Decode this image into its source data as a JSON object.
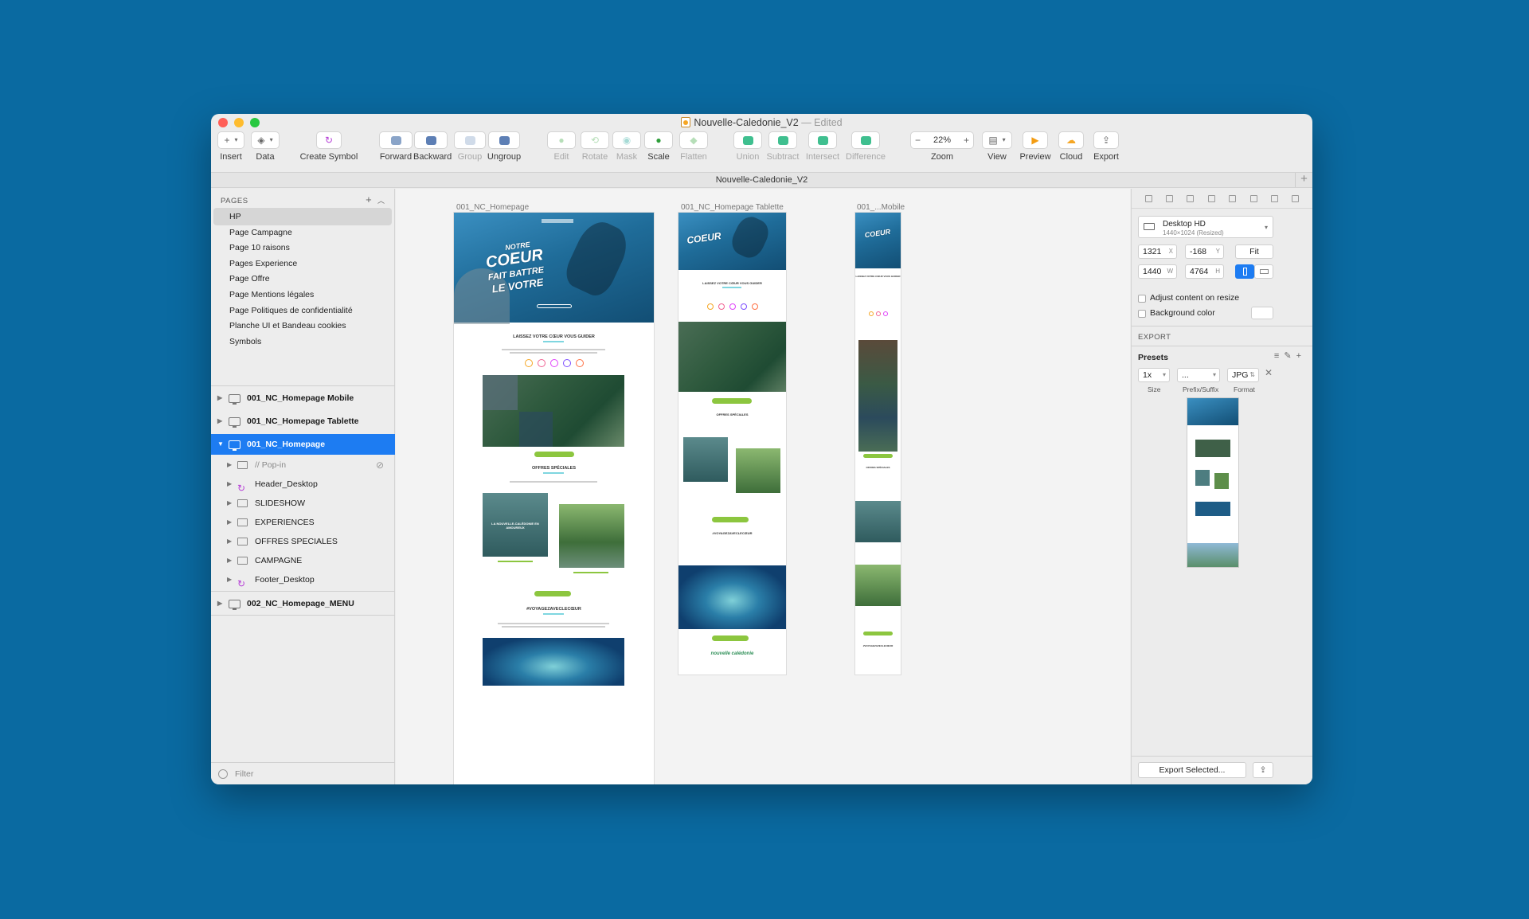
{
  "window": {
    "title": "Nouvelle-Caledonie_V2",
    "status": "— Edited",
    "document_tab": "Nouvelle-Caledonie_V2"
  },
  "toolbar": {
    "insert": "Insert",
    "data": "Data",
    "create_symbol": "Create Symbol",
    "forward": "Forward",
    "backward": "Backward",
    "group": "Group",
    "ungroup": "Ungroup",
    "edit": "Edit",
    "rotate": "Rotate",
    "mask": "Mask",
    "scale": "Scale",
    "flatten": "Flatten",
    "union": "Union",
    "subtract": "Subtract",
    "intersect": "Intersect",
    "difference": "Difference",
    "zoom_label": "Zoom",
    "zoom_value": "22%",
    "view": "View",
    "preview": "Preview",
    "cloud": "Cloud",
    "export": "Export"
  },
  "pages": {
    "header": "PAGES",
    "items": [
      "HP",
      "Page Campagne",
      "Page 10 raisons",
      "Pages Experience",
      "Page Offre",
      "Page Mentions légales",
      "Page Politiques de confidentialité",
      "Planche UI et Bandeau cookies",
      "Symbols"
    ],
    "selected": "HP"
  },
  "layers": {
    "artboards": [
      "001_NC_Homepage Mobile",
      "001_NC_Homepage Tablette",
      "001_NC_Homepage",
      "002_NC_Homepage_MENU"
    ],
    "children": [
      "// Pop-in",
      "Header_Desktop",
      "SLIDESHOW",
      "EXPERIENCES",
      "OFFRES SPECIALES",
      "CAMPAGNE",
      "Footer_Desktop"
    ],
    "filter_placeholder": "Filter"
  },
  "canvas": {
    "artboard_labels": [
      "001_NC_Homepage",
      "001_NC_Homepage Tablette",
      "001_...Mobile"
    ],
    "hero_line1": "NOTRE",
    "hero_line2": "COEUR",
    "hero_line3": "FAIT BATTRE",
    "hero_line4": "LE VOTRE",
    "section_guide": "LAISSEZ VOTRE CŒUR VOUS GUIDER",
    "section_offres": "OFFRES SPÉCIALES",
    "section_hashtag": "#VOYAGEZAVECLECŒUR",
    "brand": "nouvelle calédonie",
    "offer1": "LA NOUVELLE-CALÉDONIE EN AMOUREUX",
    "offer2": "COMME GRANDE TERRE ET ILE DES PINS"
  },
  "inspector": {
    "preset_name": "Desktop HD",
    "preset_size": "1440×1024 (Resized)",
    "x": "1321",
    "x_suffix": "X",
    "y": "-168",
    "y_suffix": "Y",
    "fit": "Fit",
    "w": "1440",
    "w_suffix": "W",
    "h": "4764",
    "h_suffix": "H",
    "adjust_content": "Adjust content on resize",
    "background_color": "Background color",
    "export_header": "EXPORT",
    "presets": "Presets",
    "size_value": "1x",
    "prefix_value": "...",
    "format_value": "JPG",
    "size_label": "Size",
    "prefix_label": "Prefix/Suffix",
    "format_label": "Format",
    "export_selected": "Export Selected..."
  },
  "colors": {
    "desktop_bg": "#0a6aa1",
    "selection": "#1d7cf2",
    "accent_green": "#8cc63f"
  }
}
